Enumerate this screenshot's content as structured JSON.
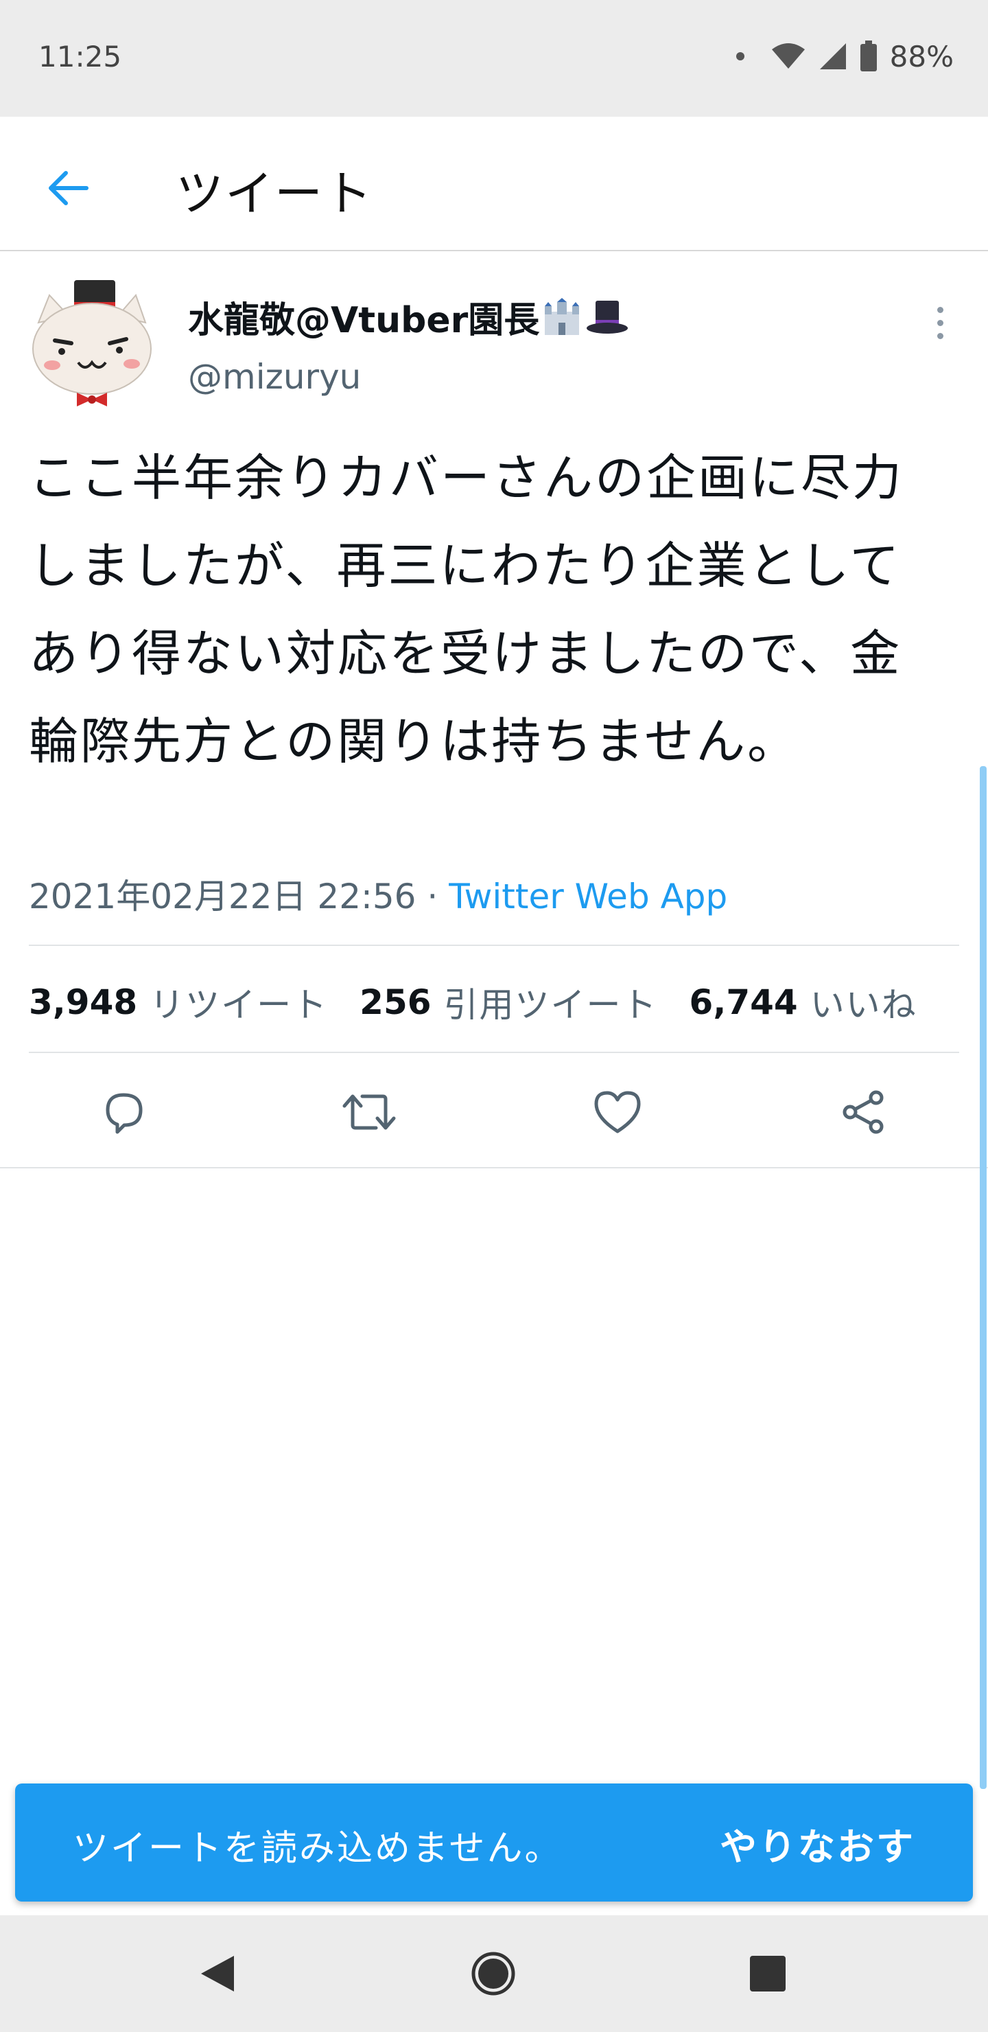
{
  "status_bar": {
    "time": "11:25",
    "battery": "88%",
    "icons": [
      "notification-dot-icon",
      "wifi-icon",
      "signal-icon",
      "battery-icon"
    ]
  },
  "header": {
    "title": "ツイート",
    "back_icon": "arrow-left-icon"
  },
  "tweet": {
    "author_name": "水龍敬@Vtuber園長",
    "author_emojis": [
      "castle-emoji-icon",
      "top-hat-emoji-icon"
    ],
    "handle": "@mizuryu",
    "text": "ここ半年余りカバーさんの企画に尽力しましたが、再三にわたり企業としてあり得ない対応を受けましたので、金輪際先方との関りは持ちません。",
    "timestamp": "2021年02月22日 22:56",
    "separator": "·",
    "source": "Twitter Web App",
    "stats": {
      "retweets_count": "3,948",
      "retweets_label": "リツイート",
      "quotes_count": "256",
      "quotes_label": "引用ツイート",
      "likes_count": "6,744",
      "likes_label": "いいね"
    },
    "actions": [
      "reply-icon",
      "retweet-icon",
      "like-icon",
      "share-icon"
    ]
  },
  "toast": {
    "message": "ツイートを読み込めません。",
    "action": "やりなおす"
  },
  "colors": {
    "accent": "#1d9bf0",
    "text_primary": "#0f1419",
    "text_secondary": "#536471",
    "status_bar_bg": "#ececec"
  },
  "nav_bar": [
    "back-triangle-icon",
    "home-circle-icon",
    "recents-square-icon"
  ]
}
